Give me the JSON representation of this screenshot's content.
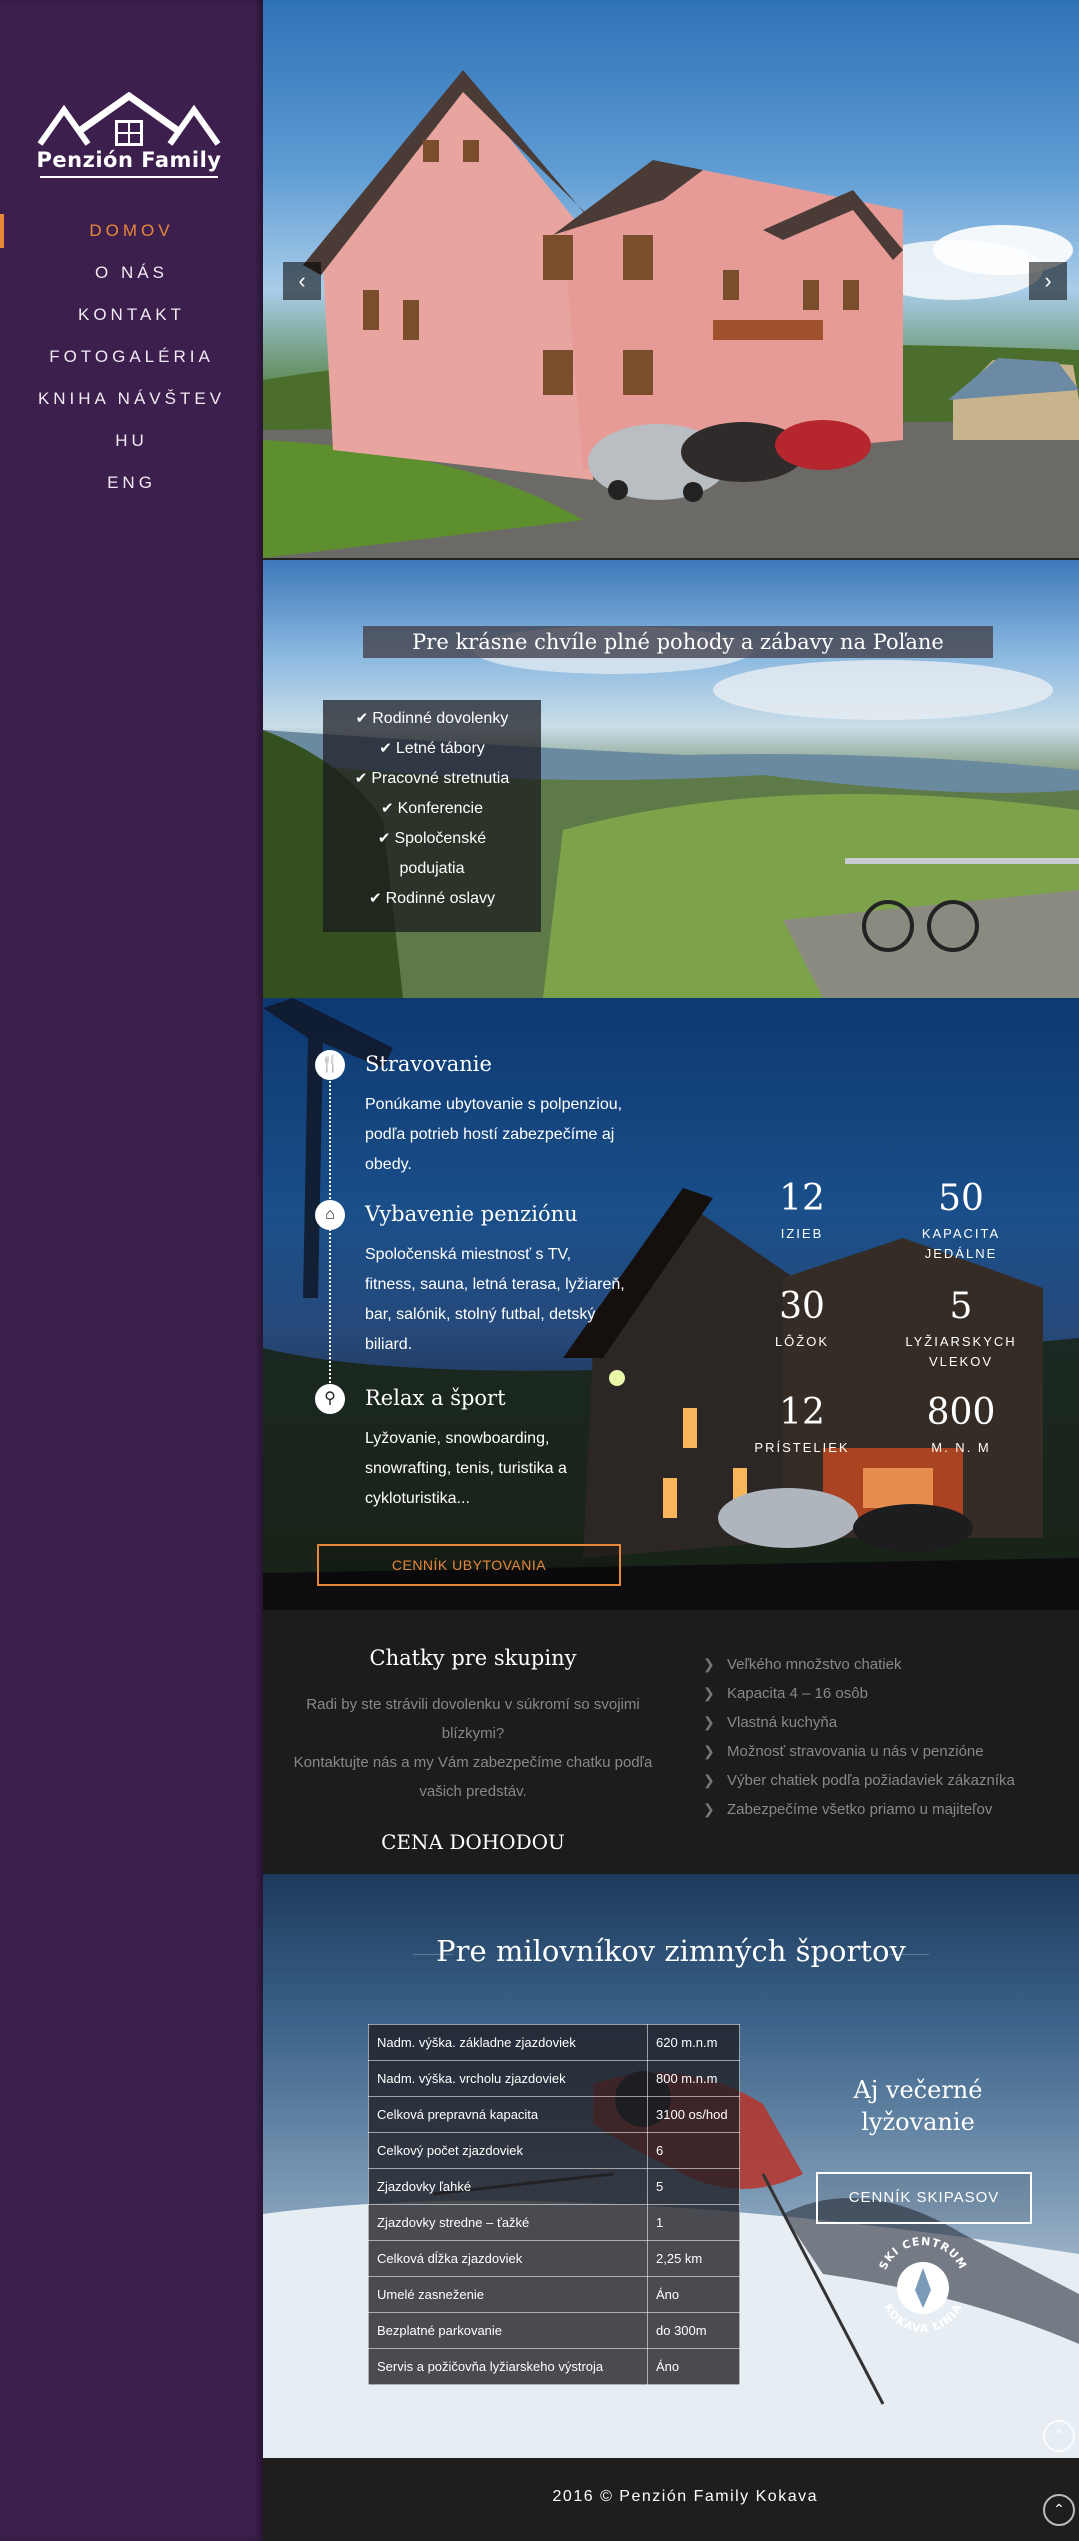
{
  "site": {
    "logo_text": "Penzión Family"
  },
  "nav": {
    "items": [
      {
        "label": "DOMOV",
        "active": true
      },
      {
        "label": "O NÁS"
      },
      {
        "label": "KONTAKT"
      },
      {
        "label": "FOTOGALÉRIA"
      },
      {
        "label": "KNIHA NÁVŠTEV"
      },
      {
        "label": "HU"
      },
      {
        "label": "ENG"
      }
    ]
  },
  "hero": {
    "prev_arrow": "‹",
    "next_arrow": "›"
  },
  "family": {
    "banner": "Pre krásne chvíle plné pohody a zábavy na Poľane",
    "items": [
      "Rodinné dovolenky",
      "Letné tábory",
      "Pracovné stretnutia",
      "Konferencie",
      "Spoločenské",
      "podujatia",
      "Rodinné oslavy"
    ]
  },
  "services": {
    "items": [
      {
        "title": "Stravovanie",
        "icon": "cutlery-icon",
        "desc": "Ponúkame ubytovanie s polpenziou, podľa potrieb hostí zabezpečíme aj obedy."
      },
      {
        "title": "Vybavenie penziónu",
        "icon": "home-icon",
        "desc": "Spoločenská miestnosť s TV, fitness, sauna, letná terasa, lyžiareň, bar, salónik, stolný futbal, detský biliard."
      },
      {
        "title": "Relax a šport",
        "icon": "bicycle-icon",
        "desc": "Lyžovanie, snowboarding, snowrafting, tenis, turistika a cykloturistika..."
      }
    ],
    "price_button": "CENNÍK UBYTOVANIA",
    "stats": [
      {
        "num": "12",
        "label": "IZIEB"
      },
      {
        "num": "50",
        "label": "KAPACITA JEDÁLNE"
      },
      {
        "num": "30",
        "label": "LÔŽOK"
      },
      {
        "num": "5",
        "label": "LYŽIARSKYCH VLEKOV"
      },
      {
        "num": "12",
        "label": "PRÍSTELIEK"
      },
      {
        "num": "800",
        "label": "M. N. M"
      }
    ]
  },
  "cottages": {
    "title": "Chatky pre skupiny",
    "desc_1": "Radi by ste strávili dovolenku v súkromí so svojimi blízkymi?",
    "desc_2": "Kontaktujte nás a my Vám zabezpečíme chatku podľa vašich predstáv.",
    "price": "CENA DOHODOU",
    "items": [
      "Veľkého množstvo chatiek",
      "Kapacita 4 – 16 osôb",
      "Vlastná kuchyňa",
      "Možnosť stravovania u nás v penzióne",
      "Výber chatiek podľa požiadaviek zákazníka",
      "Zabezpečíme všetko priamo u majiteľov"
    ]
  },
  "winter": {
    "title": "Pre milovníkov zimných športov",
    "table": [
      {
        "label": "Nadm. výška. základne zjazdoviek",
        "value": "620 m.n.m"
      },
      {
        "label": "Nadm. výška. vrcholu zjazdoviek",
        "value": "800 m.n.m"
      },
      {
        "label": "Celková prepravná kapacita",
        "value": "3100 os/hod"
      },
      {
        "label": "Celkový počet zjazdoviek",
        "value": "6"
      },
      {
        "label": "Zjazdovky ľahké",
        "value": "5"
      },
      {
        "label": "Zjazdovky stredne – ťažké",
        "value": "1"
      },
      {
        "label": "Celková dĺžka zjazdoviek",
        "value": "2,25 km"
      },
      {
        "label": "Umelé zasneženie",
        "value": "Áno"
      },
      {
        "label": "Bezplatné parkovanie",
        "value": "do 300m"
      },
      {
        "label": "Servis a požičovňa lyžiarskeho výstroja",
        "value": "Áno"
      }
    ],
    "evening_line1": "Aj večerné",
    "evening_line2": "lyžovanie",
    "skipass_button": "CENNÍK SKIPASOV",
    "logo_top": "SKI CENTRUM",
    "logo_bottom": "KOKAVA LINIA"
  },
  "footer": {
    "copyright": "2016 © Penzión Family Kokava"
  },
  "colors": {
    "sidebar": "#3d1f4d",
    "accent": "#e8873a"
  }
}
